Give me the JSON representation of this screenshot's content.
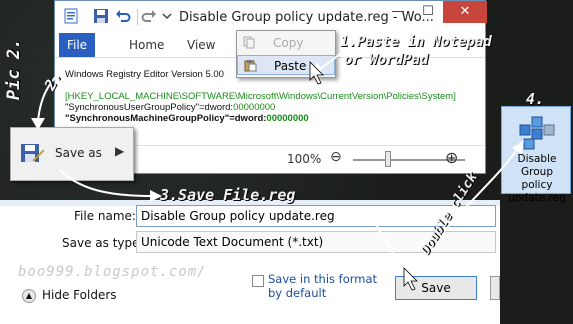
{
  "window": {
    "title": "Disable Group policy update.reg - Wo...",
    "minimize": "—",
    "maximize": "☐",
    "close": "✕"
  },
  "ribbon": {
    "tabs": [
      "File",
      "Home",
      "View"
    ]
  },
  "context_menu": {
    "copy": "Copy",
    "paste": "Paste"
  },
  "document": {
    "line1": "Windows Registry Editor Version 5.00",
    "line2": "[HKEY_LOCAL_MACHINE\\SOFTWARE\\Microsoft\\Windows\\CurrentVersion\\Policies\\System]",
    "line3_key": "\"SynchronousUserGroupPolicy\"",
    "line3_val": "=dword:",
    "line3_num": "00000000",
    "line4_key": "\"SynchronousMachineGroupPolicy\"",
    "line4_val": "=dword:",
    "line4_num": "00000000"
  },
  "statusbar": {
    "zoom": "100%",
    "zoom_minus": "⊖",
    "zoom_plus": "⊕"
  },
  "save_as_menu": {
    "label": "Save as",
    "arrow": "▶"
  },
  "reg_file": {
    "name_line1": "Disable",
    "name_line2": "Group policy",
    "name_line3": "update.reg"
  },
  "dialog": {
    "filename_label": "File name:",
    "filename_value": "Disable Group policy update.reg",
    "savetype_label": "Save as type:",
    "savetype_value": "Unicode Text Document (*.txt)",
    "hide_folders": "Hide Folders",
    "format_checkbox": "Save in this format by default",
    "save_button": "Save"
  },
  "annotations": {
    "pic": "Pic 2.",
    "step1": "1.Paste in Notepad",
    "step1b": "or WordPad",
    "step2": "2.",
    "step3": "3.Save File.reg",
    "step4": "4.",
    "double_click": "Double click",
    "blog": "boo999.blogspot.com/"
  },
  "colors": {
    "file_tab": "#2a5ec1",
    "close_button": "#c7453b",
    "registry_key_text": "#1a8c1a",
    "link_text": "#1a4e9c"
  }
}
